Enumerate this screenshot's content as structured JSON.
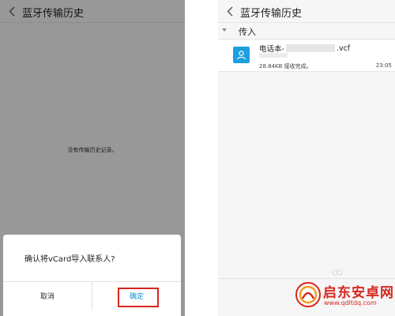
{
  "left_screen": {
    "header": {
      "title": "蓝牙传输历史",
      "back_icon": "chevron-left-icon"
    },
    "empty_message": "没有传输历史记录。",
    "dialog": {
      "message": "确认将vCard导入联系人?",
      "cancel_label": "取消",
      "confirm_label": "确定",
      "highlight_color": "#d7261e"
    }
  },
  "right_screen": {
    "header": {
      "title": "蓝牙传输历史",
      "back_icon": "chevron-left-icon"
    },
    "group": {
      "label": "传入",
      "icon": "triangle-down-icon"
    },
    "transfers": [
      {
        "name_prefix": "电话本-",
        "name_suffix": ".vcf",
        "status": "28.84KB 接收完成。",
        "time": "23:05",
        "icon": "contact-card-icon",
        "icon_color": "#1ea0e0"
      }
    ]
  },
  "watermark": {
    "title": "启东安卓网",
    "url": "www.qdltdq.com",
    "color": "#d7261e"
  }
}
